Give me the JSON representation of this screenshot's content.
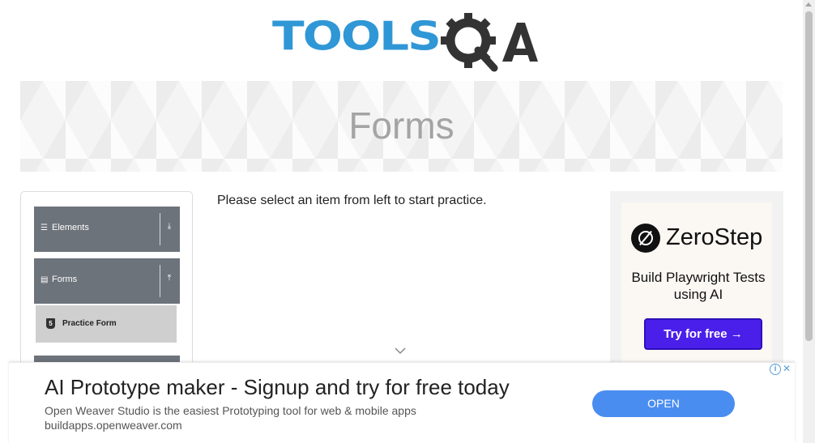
{
  "header": {
    "logo_text": "TOOLS",
    "logo_suffix": "QA",
    "logo_colors": {
      "tools": "#2f97d6",
      "qa": "#333333"
    }
  },
  "banner": {
    "title": "Forms"
  },
  "sidebar": {
    "groups": [
      {
        "label": "Elements",
        "icon": "hamburger-icon",
        "toggle_icon": "download-arrow-icon",
        "expanded": false
      },
      {
        "label": "Forms",
        "icon": "document-icon",
        "toggle_icon": "upload-arrow-icon",
        "expanded": true,
        "items": [
          {
            "label": "Practice Form",
            "icon": "html5-icon",
            "icon_glyph": "5"
          }
        ]
      }
    ]
  },
  "main": {
    "instruction": "Please select an item from left to start practice."
  },
  "side_ad": {
    "brand": "ZeroStep",
    "tagline": "Build Playwright Tests using AI",
    "cta": "Try for free →",
    "cta_color": "#4a1fea"
  },
  "bottom_ad": {
    "title": "AI Prototype maker - Signup and try for free today",
    "description": "Open Weaver Studio is the easiest Prototyping tool for web & mobile apps",
    "url": "buildapps.openweaver.com",
    "button": "OPEN",
    "button_color": "#4a8df0",
    "adchoices_glyph": "i",
    "close_glyph": "✕"
  }
}
